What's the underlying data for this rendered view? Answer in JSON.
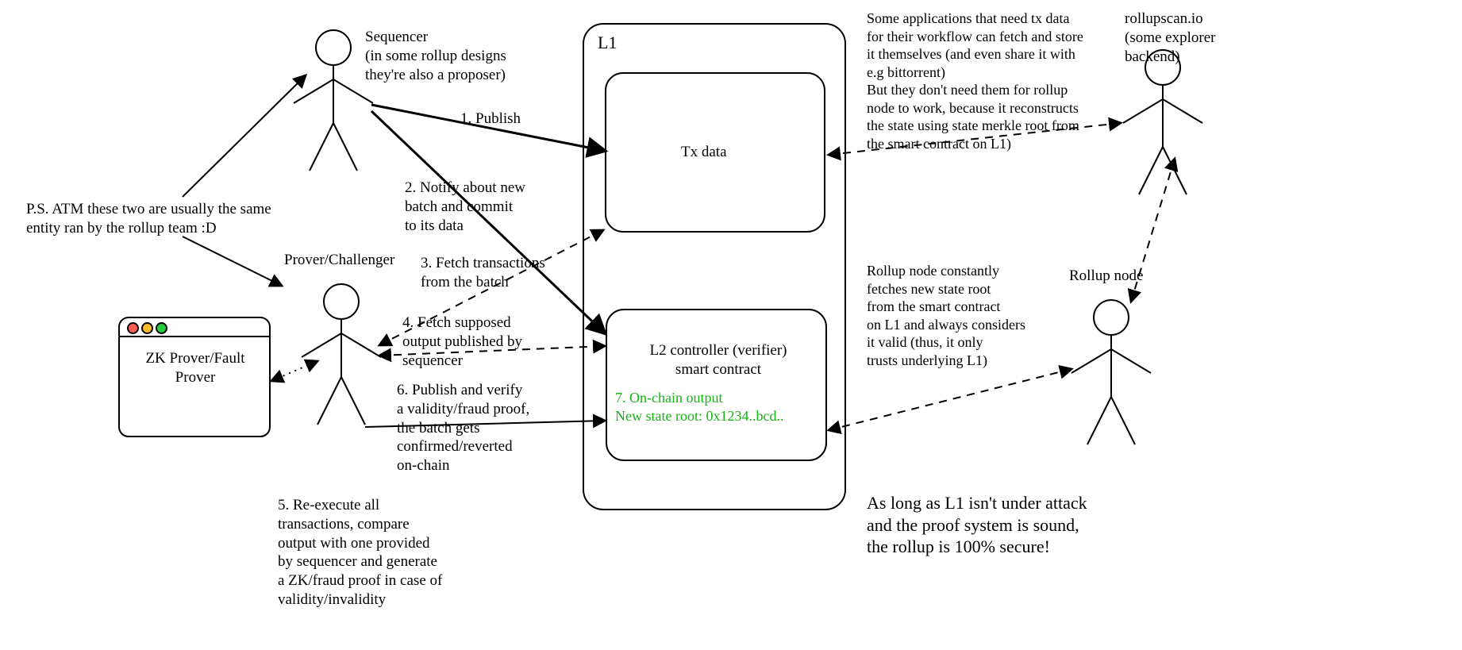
{
  "actors": {
    "sequencer": {
      "label": "Sequencer\n(in some rollup designs\nthey're also a proposer)"
    },
    "prover": {
      "label": "Prover/Challenger"
    },
    "explorer": {
      "label": "rollupscan.io\n(some explorer\nbackend)"
    },
    "rollup_node": {
      "label": "Rollup node"
    }
  },
  "l1": {
    "label": "L1",
    "tx_box": "Tx data",
    "contract_box": "L2 controller (verifier)\nsmart contract",
    "onchain_output": "7. On-chain output\nNew state root: 0x1234..bcd.."
  },
  "zk_window": {
    "label": "ZK Prover/Fault\nProver"
  },
  "arrows": {
    "a1": "1. Publish",
    "a2": "2. Notify about new\nbatch and commit\nto its data",
    "a3": "3. Fetch transactions\nfrom the batch",
    "a4": "4. Fetch supposed\noutput published by\nsequencer",
    "a6": "6. Publish and verify\na validity/fraud proof,\nthe batch gets\nconfirmed/reverted\non-chain"
  },
  "notes": {
    "ps": "P.S. ATM these two are usually the same\nentity ran by the rollup team :D",
    "step5": "5. Re-execute all\ntransactions, compare\noutput with one provided\nby sequencer and generate\na ZK/fraud proof in case of\nvalidity/invalidity",
    "apps": "Some applications that need tx data\nfor their workflow can fetch and store\nit themselves (and even share it with\ne.g bittorrent)\nBut they don't need them for rollup\nnode to work, because it reconstructs\nthe state using state merkle root from\nthe smart contract on L1)",
    "node": "Rollup node constantly\nfetches new state root\nfrom the smart contract\non L1 and always considers\nit valid (thus, it only\ntrusts underlying L1)",
    "security": "As long as L1 isn't under attack\nand the proof system is sound,\nthe rollup is 100% secure!"
  }
}
